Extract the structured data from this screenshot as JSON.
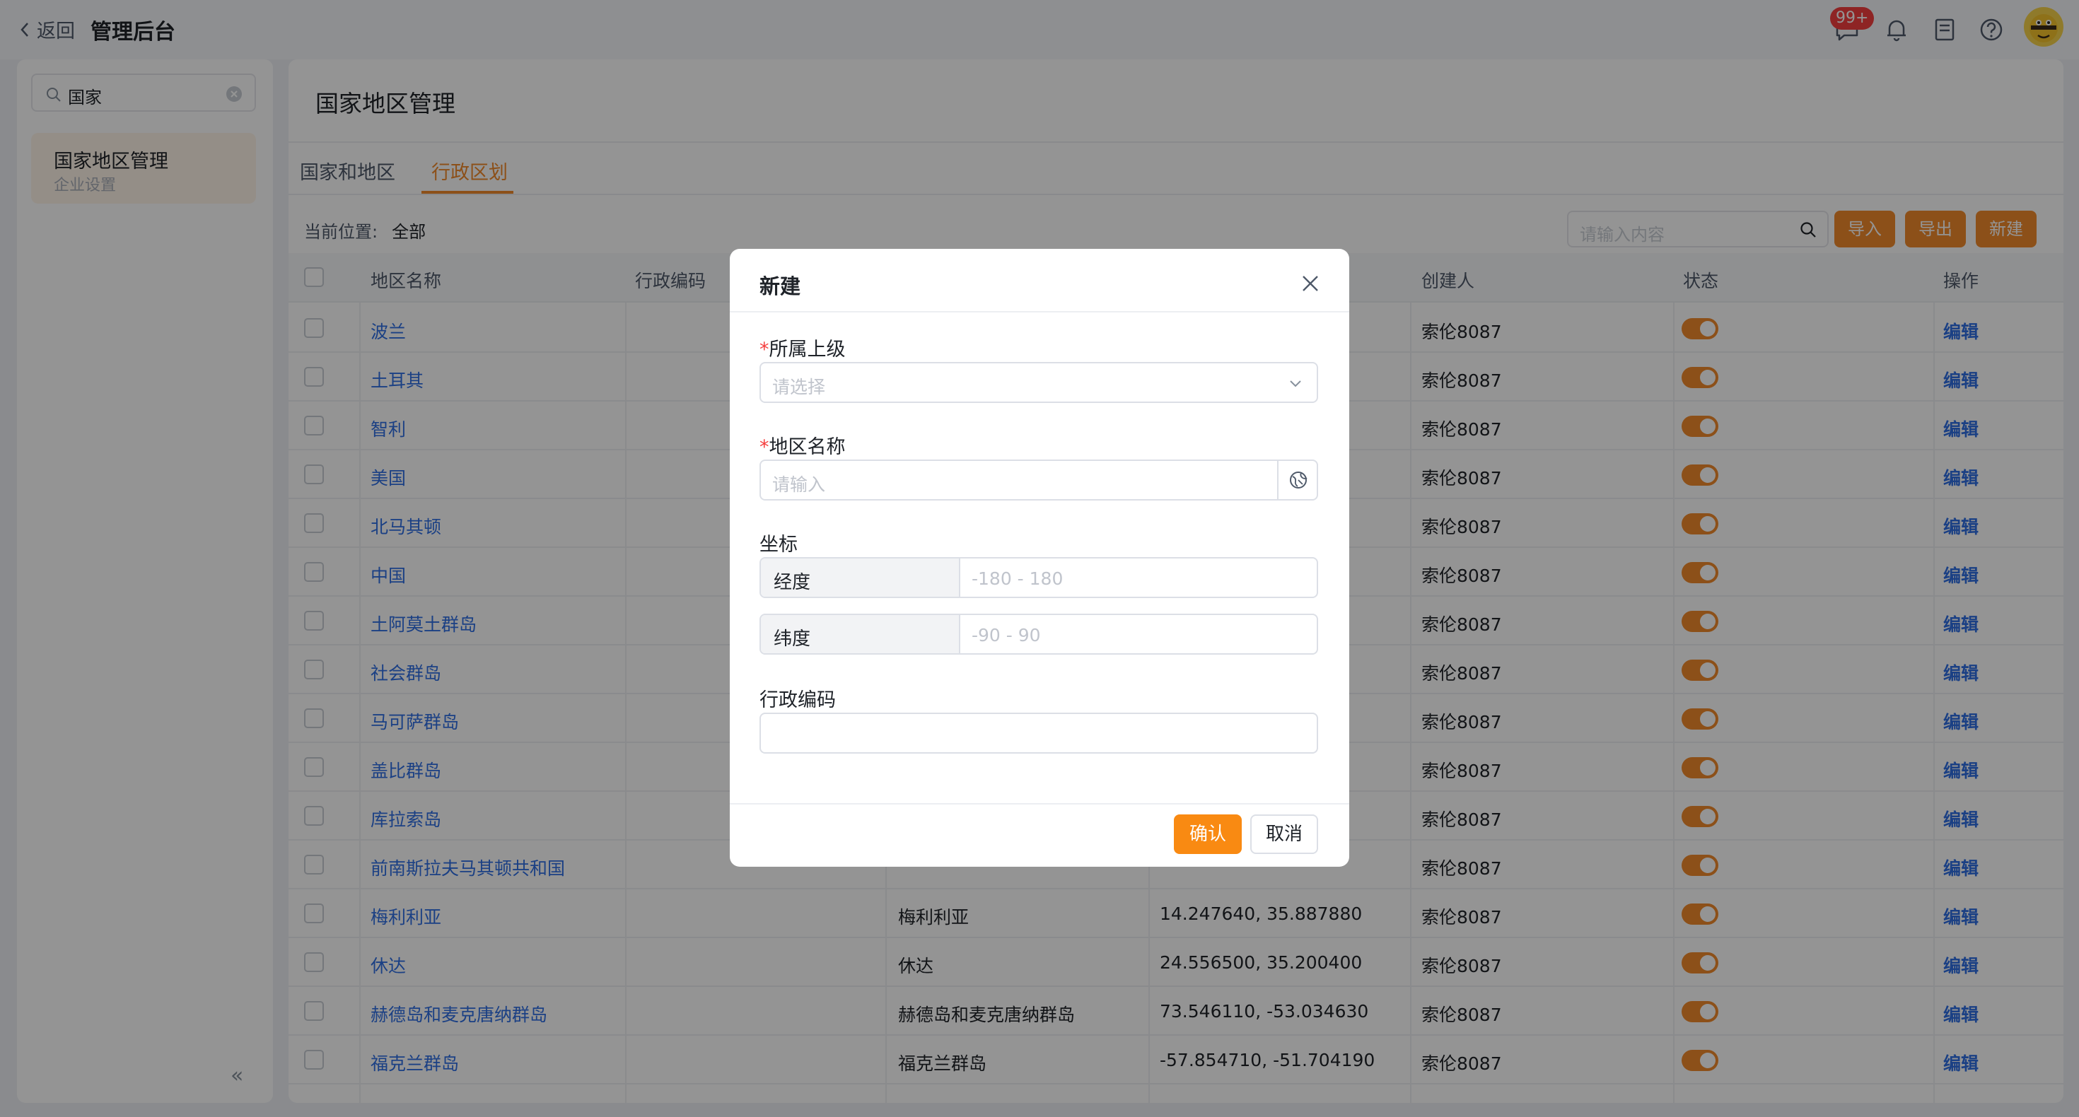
{
  "topbar": {
    "back_label": "返回",
    "title": "管理后台",
    "message_badge": "99+",
    "icons": [
      "message-icon",
      "bell-icon",
      "document-icon",
      "help-icon",
      "avatar"
    ]
  },
  "sidebar": {
    "search_value": "国家",
    "item": {
      "title": "国家地区管理",
      "subtitle": "企业设置"
    },
    "collapse_glyph": "«"
  },
  "main": {
    "page_title": "国家地区管理",
    "tabs": [
      {
        "label": "国家和地区",
        "active": false
      },
      {
        "label": "行政区划",
        "active": true
      }
    ],
    "breadcrumb": {
      "label": "当前位置:",
      "value": "全部"
    },
    "search_placeholder": "请输入内容",
    "buttons": {
      "import": "导入",
      "export": "导出",
      "new": "新建"
    },
    "table": {
      "columns": [
        "地区名称",
        "行政编码",
        "创建人",
        "状态",
        "操作"
      ],
      "rows": [
        {
          "name": "波兰",
          "creator": "索伦8087",
          "action": "编辑"
        },
        {
          "name": "土耳其",
          "creator": "索伦8087",
          "action": "编辑"
        },
        {
          "name": "智利",
          "creator": "索伦8087",
          "action": "编辑"
        },
        {
          "name": "美国",
          "creator": "索伦8087",
          "action": "编辑"
        },
        {
          "name": "北马其顿",
          "creator": "索伦8087",
          "action": "编辑"
        },
        {
          "name": "中国",
          "creator": "索伦8087",
          "action": "编辑"
        },
        {
          "name": "土阿莫土群岛",
          "creator": "索伦8087",
          "action": "编辑"
        },
        {
          "name": "社会群岛",
          "creator": "索伦8087",
          "action": "编辑"
        },
        {
          "name": "马可萨群岛",
          "creator": "索伦8087",
          "action": "编辑"
        },
        {
          "name": "盖比群岛",
          "creator": "索伦8087",
          "action": "编辑"
        },
        {
          "name": "库拉索岛",
          "creator": "索伦8087",
          "action": "编辑"
        },
        {
          "name": "前南斯拉夫马其顿共和国",
          "creator": "索伦8087",
          "action": "编辑"
        },
        {
          "name": "梅利利亚",
          "full_name": "梅利利亚",
          "coords": "14.247640, 35.887880",
          "creator": "索伦8087",
          "action": "编辑"
        },
        {
          "name": "休达",
          "full_name": "休达",
          "coords": "24.556500, 35.200400",
          "creator": "索伦8087",
          "action": "编辑"
        },
        {
          "name": "赫德岛和麦克唐纳群岛",
          "full_name": "赫德岛和麦克唐纳群岛",
          "coords": "73.546110, -53.034630",
          "creator": "索伦8087",
          "action": "编辑"
        },
        {
          "name": "福克兰群岛",
          "full_name": "福克兰群岛",
          "coords": "-57.854710, -51.704190",
          "creator": "索伦8087",
          "action": "编辑"
        }
      ]
    }
  },
  "modal": {
    "title": "新建",
    "parent": {
      "label": "所属上级",
      "required": true,
      "placeholder": "请选择"
    },
    "name": {
      "label": "地区名称",
      "required": true,
      "placeholder": "请输入"
    },
    "coordinates": {
      "label": "坐标",
      "longitude": {
        "label": "经度",
        "placeholder": "-180 - 180"
      },
      "latitude": {
        "label": "纬度",
        "placeholder": "-90 - 90"
      }
    },
    "code": {
      "label": "行政编码",
      "value": ""
    },
    "confirm": "确认",
    "cancel": "取消"
  },
  "colors": {
    "accent": "#f28a2b",
    "link": "#2f6fe4",
    "danger": "#f53f3f"
  }
}
